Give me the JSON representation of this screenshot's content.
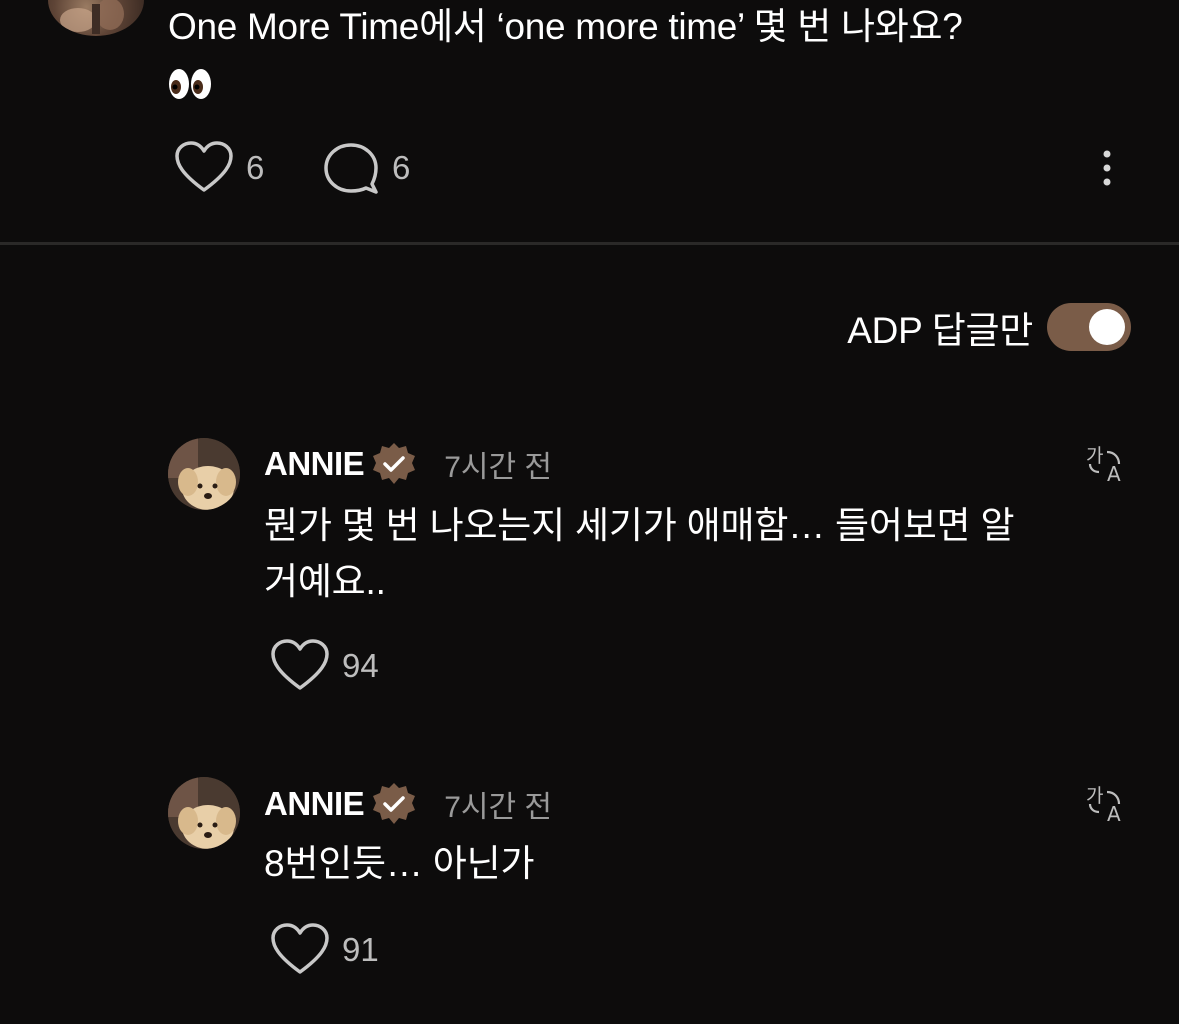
{
  "post": {
    "text": "One More Time에서 ‘one more time’ 몇 번 나와요?",
    "emoji": "👀",
    "like_count": "6",
    "reply_count": "6"
  },
  "filter": {
    "label": "ADP 답글만",
    "enabled": true
  },
  "replies": [
    {
      "author": "ANNIE",
      "time": "7시간 전",
      "text": "뭔가 몇 번 나오는지 세기가 애매함… 들어보면 알 거예요..",
      "likes": "94"
    },
    {
      "author": "ANNIE",
      "time": "7시간 전",
      "text": "8번인듯… 아닌가",
      "likes": "91"
    }
  ],
  "colors": {
    "background": "#0d0c0c",
    "accent": "#7a5c48",
    "muted_text": "#9a9a9a"
  },
  "icons": [
    "heart-icon",
    "speech-bubble-icon",
    "more-vertical-icon",
    "verified-badge-icon",
    "translate-icon"
  ]
}
